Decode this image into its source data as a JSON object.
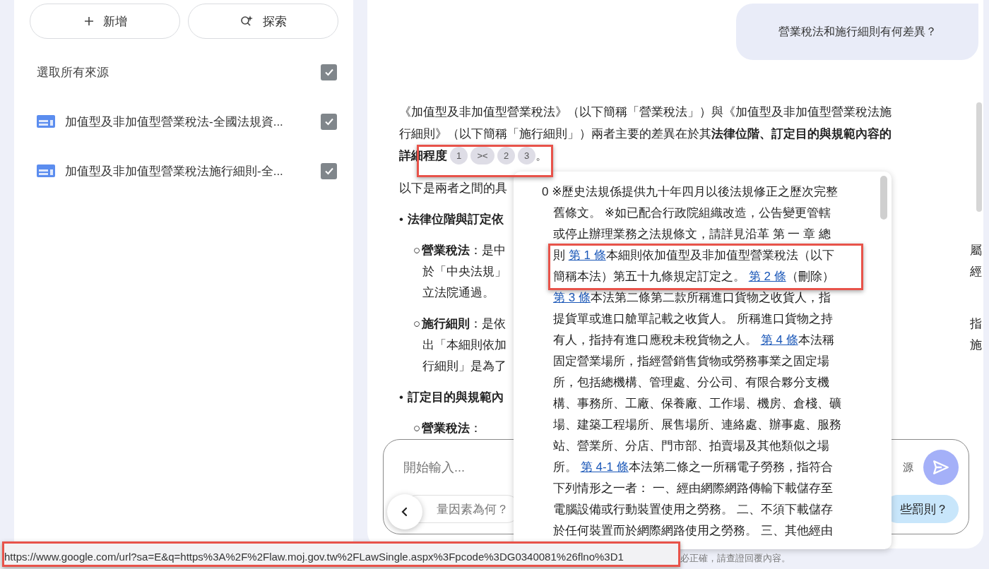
{
  "sidebar": {
    "buttons": [
      {
        "kind": "add",
        "label": "新增"
      },
      {
        "kind": "explore",
        "label": "探索"
      }
    ],
    "select_all": {
      "label": "選取所有來源",
      "checked": true
    },
    "sources": [
      {
        "title": "加值型及非加值型營業稅法-全國法規資...",
        "checked": true
      },
      {
        "title": "加值型及非加值型營業稅法施行細則-全...",
        "checked": true
      }
    ]
  },
  "chat": {
    "user_message": "營業稅法和施行細則有何差異？",
    "answer": {
      "intro": "《加值型及非加值型營業稅法》（以下簡稱「營業稅法」）與《加值型及非加值型營業稅法施行細則》（以下簡稱「施行細則」）兩者主要的差異在於其**法律位階、訂定目的與規範內容的**",
      "intro_cont": "詳細程度",
      "citations": [
        {
          "label": "1"
        },
        {
          "label": "><"
        },
        {
          "label": "2"
        },
        {
          "label": "3"
        }
      ],
      "intro_end": "。",
      "lines": [
        {
          "kind": "text",
          "text": "以下是兩者之間的具"
        },
        {
          "kind": "bullet",
          "marker": "•",
          "text": "法律位階與訂定依"
        },
        {
          "kind": "sub",
          "marker": "○",
          "text": "**營業稅法**：是中",
          "right": "屬"
        },
        {
          "kind": "cont",
          "text": "於「中央法規」",
          "right": "經"
        },
        {
          "kind": "cont",
          "text": "立法院通過。"
        },
        {
          "kind": "sub",
          "marker": "○",
          "text": "**施行細則**：是依",
          "right": "指"
        },
        {
          "kind": "cont",
          "text": "出「本細則依加",
          "right": "施"
        },
        {
          "kind": "cont",
          "text": "行細則」是為了"
        },
        {
          "kind": "bullet",
          "marker": "•",
          "text": "訂定目的與規範內"
        },
        {
          "kind": "sub",
          "marker": "○",
          "text": "**營業稅法**："
        }
      ]
    }
  },
  "source_popup": {
    "lines": [
      [
        {
          "kind": "text",
          "text": "0 ※歷史法規係提供九十年四月以後法規修正之歷次完整"
        }
      ],
      [
        {
          "kind": "text",
          "text": "舊條文。 ※如已配合行政院組織改造，公告變更管轄"
        }
      ],
      [
        {
          "kind": "text",
          "text": "或停止辦理業務之法規條文，請詳見沿革 第 一 章 總"
        }
      ],
      [
        {
          "kind": "text",
          "text": "則 "
        },
        {
          "kind": "link",
          "text": "第 1 條"
        },
        {
          "kind": "text",
          "text": "本細則依加值型及非加值型營業稅法（以下"
        }
      ],
      [
        {
          "kind": "text",
          "text": "簡稱本法）第五十九條規定訂定之。 "
        },
        {
          "kind": "link",
          "text": "第 2 條"
        },
        {
          "kind": "text",
          "text": "（刪除）"
        }
      ],
      [
        {
          "kind": "link",
          "text": "第 3 條"
        },
        {
          "kind": "text",
          "text": "本法第二條第二款所稱進口貨物之收貨人，指"
        }
      ],
      [
        {
          "kind": "text",
          "text": "提貨單或進口艙單記載之收貨人。 所稱進口貨物之持"
        }
      ],
      [
        {
          "kind": "text",
          "text": "有人，指持有進口應稅未稅貨物之人。 "
        },
        {
          "kind": "link",
          "text": "第 4 條"
        },
        {
          "kind": "text",
          "text": "本法稱"
        }
      ],
      [
        {
          "kind": "text",
          "text": "固定營業場所，指經營銷售貨物或勞務事業之固定場"
        }
      ],
      [
        {
          "kind": "text",
          "text": "所，包括總機構、管理處、分公司、有限合夥分支機"
        }
      ],
      [
        {
          "kind": "text",
          "text": "構、事務所、工廠、保養廠、工作場、機房、倉棧、礦"
        }
      ],
      [
        {
          "kind": "text",
          "text": "場、建築工程場所、展售場所、連絡處、辦事處、服務"
        }
      ],
      [
        {
          "kind": "text",
          "text": "站、營業所、分店、門市部、拍賣場及其他類似之場"
        }
      ],
      [
        {
          "kind": "text",
          "text": "所。 "
        },
        {
          "kind": "link",
          "text": "第 4-1 條"
        },
        {
          "kind": "text",
          "text": "本法第二條之一所稱電子勞務，指符合"
        }
      ],
      [
        {
          "kind": "text",
          "text": "下列情形之一者： 一、經由網際網路傳輸下載儲存至"
        }
      ],
      [
        {
          "kind": "text",
          "text": "電腦設備或行動裝置使用之勞務。 二、不須下載儲存"
        }
      ],
      [
        {
          "kind": "text",
          "text": "於任何裝置而於網際網路使用之勞務。 三、其他經由"
        }
      ]
    ]
  },
  "composer": {
    "placeholder": "開始輸入...",
    "source_count": "源",
    "suggestions": [
      {
        "text": "量因素為何？",
        "kind": "plain"
      },
      {
        "text": "些罰則？",
        "kind": "highlighted"
      }
    ]
  },
  "footer": {
    "disclaimer": "必正確，請查證回覆內容。"
  },
  "status_bar": {
    "url": "https://www.google.com/url?sa=E&q=https%3A%2F%2Flaw.moj.gov.tw%2FLawSingle.aspx%3Fpcode%3DG0340081%26flno%3D1"
  }
}
